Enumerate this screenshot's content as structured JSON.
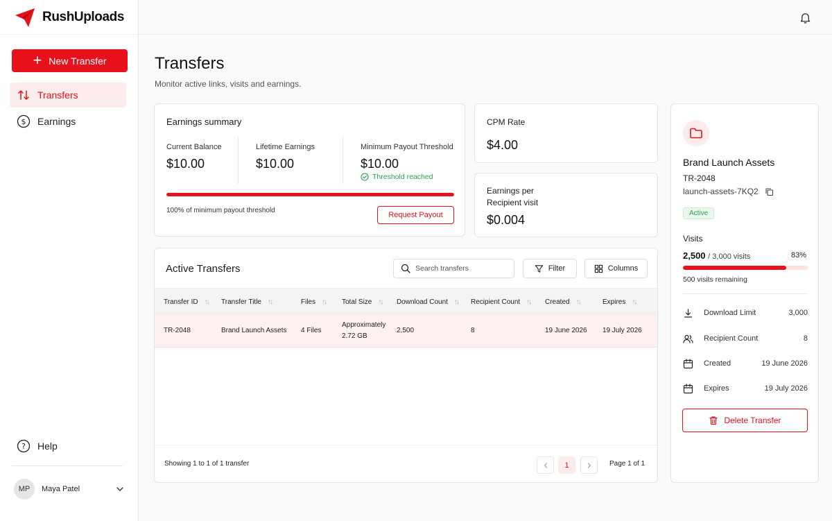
{
  "brand": {
    "name": "RushUploads",
    "accent": "#e8101a"
  },
  "sidebar": {
    "new_transfer_label": "New Transfer",
    "items": [
      {
        "label": "Transfers",
        "icon": "arrows-up-down-icon",
        "active": true
      },
      {
        "label": "Earnings",
        "icon": "dollar-circle-icon",
        "active": false
      }
    ],
    "help_label": "Help",
    "user": {
      "initials": "MP",
      "name": "Maya Patel"
    }
  },
  "header": {
    "title": "Transfers",
    "subtitle": "Monitor active links, visits and earnings."
  },
  "summary": {
    "title": "Earnings summary",
    "current_balance_label": "Current Balance",
    "current_balance": "$10.00",
    "lifetime_label": "Lifetime Earnings",
    "lifetime": "$10.00",
    "threshold_label": "Minimum Payout Threshold",
    "threshold": "$10.00",
    "threshold_status": "Threshold reached",
    "progress_fraction": 1.0,
    "progress_text": "100% of minimum payout threshold",
    "request_label": "Request Payout"
  },
  "cpm": {
    "label": "CPM Rate",
    "value": "$4.00"
  },
  "epv": {
    "label_line1": "Earnings per",
    "label_line2": "Recipient visit",
    "value": "$0.004"
  },
  "table": {
    "title": "Active Transfers",
    "search_placeholder": "Search transfers",
    "filter_label": "Filter",
    "columns_label": "Columns",
    "headers": [
      "Transfer ID",
      "Transfer Title",
      "Files",
      "Total Size",
      "Download Count",
      "Recipient Count",
      "Created",
      "Expires"
    ],
    "rows": [
      {
        "id": "TR-2048",
        "title": "Brand Launch Assets",
        "files": "4 Files",
        "size_line1": "Approximately",
        "size_line2": "2.72 GB",
        "downloads": "2,500",
        "recipients": "8",
        "created": "19 June 2026",
        "expires": "19 July 2026"
      }
    ],
    "showing": "Showing 1 to 1 of 1 transfer",
    "current_page": "1",
    "page_info": "Page 1 of 1"
  },
  "details": {
    "title": "Brand Launch Assets",
    "id": "TR-2048",
    "slug": "launch-assets-7KQ2",
    "status": "Active",
    "visits_label": "Visits",
    "visits_count": "2,500",
    "visits_total": "/ 3,000 visits",
    "visits_percent": "83%",
    "visits_fraction": 0.83,
    "visits_remaining": "500 visits remaining",
    "rows": [
      {
        "label": "Download Limit",
        "value": "3,000",
        "icon": "download-icon"
      },
      {
        "label": "Recipient Count",
        "value": "8",
        "icon": "users-icon"
      },
      {
        "label": "Created",
        "value": "19 June 2026",
        "icon": "calendar-icon"
      },
      {
        "label": "Expires",
        "value": "19 July 2026",
        "icon": "calendar-icon"
      }
    ],
    "delete_label": "Delete Transfer"
  }
}
